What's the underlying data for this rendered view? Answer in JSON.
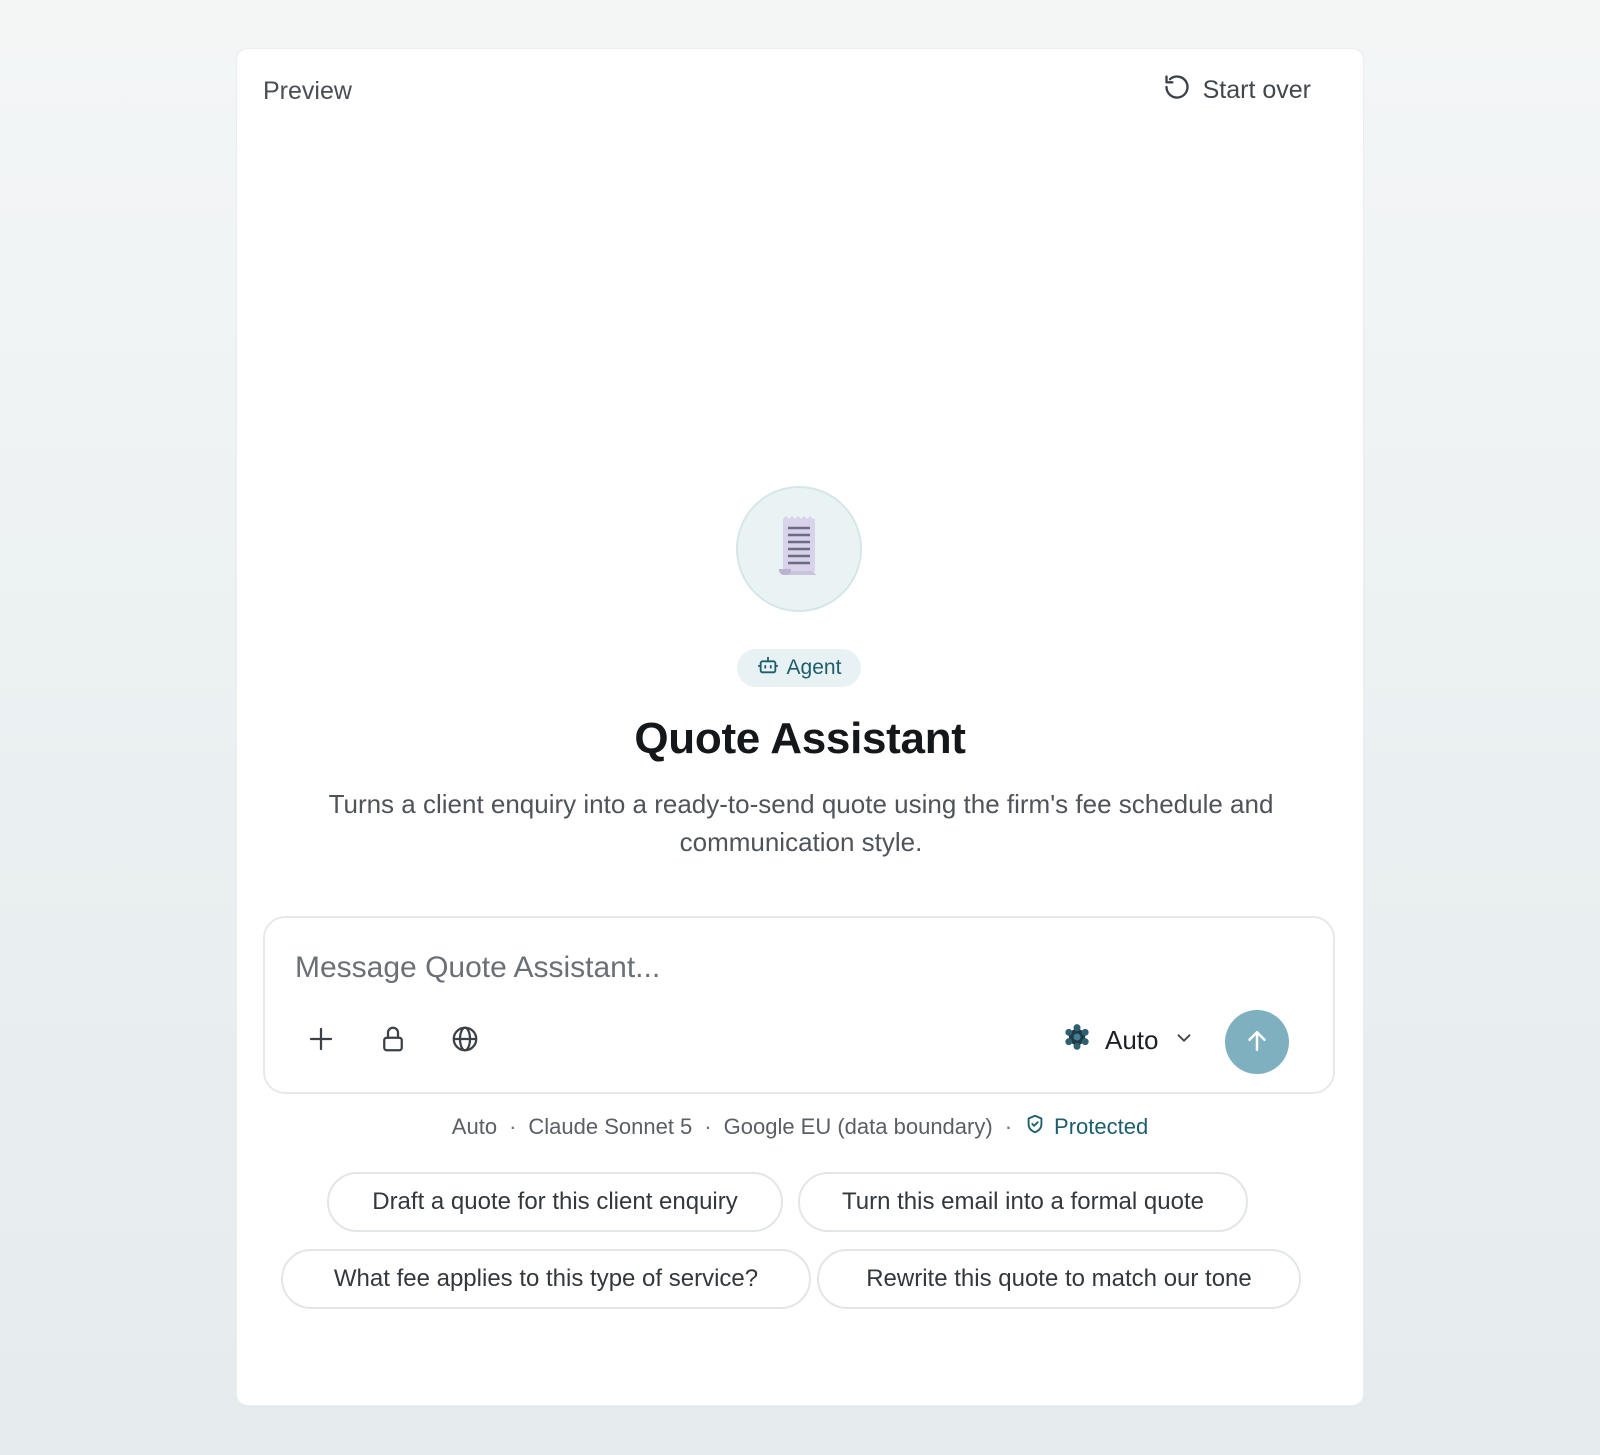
{
  "header": {
    "title": "Preview",
    "start_over_label": "Start over"
  },
  "agent": {
    "badge_label": "Agent",
    "name": "Quote Assistant",
    "description": "Turns a client enquiry into a ready-to-send quote using the firm's fee schedule and communication style.",
    "avatar_icon": "receipt-icon"
  },
  "composer": {
    "placeholder": "Message Quote Assistant...",
    "value": "",
    "tools": [
      "plus-icon",
      "lock-icon",
      "globe-icon"
    ],
    "model_label": "Auto",
    "send_icon": "arrow-up-icon"
  },
  "info": {
    "mode": "Auto",
    "model": "Claude Sonnet 5",
    "region": "Google EU (data boundary)",
    "status": "Protected"
  },
  "suggestions": [
    "Draft a quote for this client enquiry",
    "Turn this email into a formal quote",
    "What fee applies to this type of service?",
    "Rewrite this quote to match our tone"
  ],
  "colors": {
    "accent": "#1d5e6d",
    "send_button": "#7fb0c0",
    "badge_bg": "#e8f2f4",
    "avatar_bg": "#eaf3f4"
  }
}
